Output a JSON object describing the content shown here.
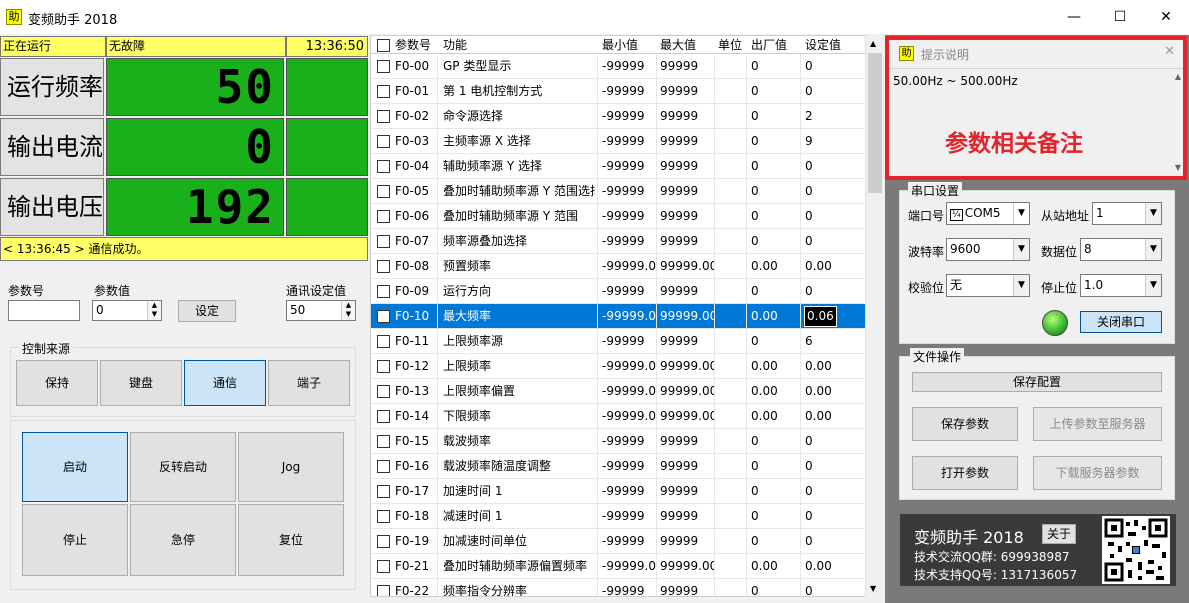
{
  "window": {
    "title": "变频助手 2018",
    "icon_glyph": "助",
    "minimize": "—",
    "maximize": "☐",
    "close": "✕"
  },
  "status": {
    "running": "正在运行",
    "fault": "无故障",
    "clock": "13:36:50"
  },
  "readouts": [
    {
      "label": "运行频率",
      "value": "50"
    },
    {
      "label": "输出电流",
      "value": "0"
    },
    {
      "label": "输出电压",
      "value": "192"
    }
  ],
  "message": "< 13:36:45 > 通信成功。",
  "param_form": {
    "param_no_label": "参数号",
    "param_no_value": "",
    "param_val_label": "参数值",
    "param_val_value": "0",
    "set_button": "设定",
    "comm_label": "通讯设定值",
    "comm_value": "50"
  },
  "control_source": {
    "title": "控制来源",
    "buttons": [
      "保持",
      "键盘",
      "通信",
      "端子"
    ],
    "active": "通信"
  },
  "control_buttons": [
    "启动",
    "反转启动",
    "Jog",
    "停止",
    "急停",
    "复位"
  ],
  "grid": {
    "headers": [
      "参数号",
      "功能",
      "最小值",
      "最大值",
      "单位",
      "出厂值",
      "设定值"
    ],
    "rows": [
      [
        "F0-00",
        "GP 类型显示",
        "-99999",
        "99999",
        "",
        "0",
        "0"
      ],
      [
        "F0-01",
        "第 1 电机控制方式",
        "-99999",
        "99999",
        "",
        "0",
        "0"
      ],
      [
        "F0-02",
        "命令源选择",
        "-99999",
        "99999",
        "",
        "0",
        "2"
      ],
      [
        "F0-03",
        "主频率源 X 选择",
        "-99999",
        "99999",
        "",
        "0",
        "9"
      ],
      [
        "F0-04",
        "辅助频率源 Y 选择",
        "-99999",
        "99999",
        "",
        "0",
        "0"
      ],
      [
        "F0-05",
        "叠加时辅助频率源 Y 范围选择",
        "-99999",
        "99999",
        "",
        "0",
        "0"
      ],
      [
        "F0-06",
        "叠加时辅助频率源 Y 范围",
        "-99999",
        "99999",
        "",
        "0",
        "0"
      ],
      [
        "F0-07",
        "频率源叠加选择",
        "-99999",
        "99999",
        "",
        "0",
        "0"
      ],
      [
        "F0-08",
        "预置频率",
        "-99999.0",
        "99999.00",
        "",
        "0.00",
        "0.00"
      ],
      [
        "F0-09",
        "运行方向",
        "-99999",
        "99999",
        "",
        "0",
        "0"
      ],
      [
        "F0-10",
        "最大频率",
        "-99999.0",
        "99999.00",
        "",
        "0.00",
        "0.06"
      ],
      [
        "F0-11",
        "上限频率源",
        "-99999",
        "99999",
        "",
        "0",
        "6"
      ],
      [
        "F0-12",
        "上限频率",
        "-99999.0",
        "99999.00",
        "",
        "0.00",
        "0.00"
      ],
      [
        "F0-13",
        "上限频率偏置",
        "-99999.0",
        "99999.00",
        "",
        "0.00",
        "0.00"
      ],
      [
        "F0-14",
        "下限频率",
        "-99999.0",
        "99999.00",
        "",
        "0.00",
        "0.00"
      ],
      [
        "F0-15",
        "载波频率",
        "-99999",
        "99999",
        "",
        "0",
        "0"
      ],
      [
        "F0-16",
        "载波频率随温度调整",
        "-99999",
        "99999",
        "",
        "0",
        "0"
      ],
      [
        "F0-17",
        "加速时间 1",
        "-99999",
        "99999",
        "",
        "0",
        "0"
      ],
      [
        "F0-18",
        "减速时间 1",
        "-99999",
        "99999",
        "",
        "0",
        "0"
      ],
      [
        "F0-19",
        "加减速时间单位",
        "-99999",
        "99999",
        "",
        "0",
        "0"
      ],
      [
        "F0-21",
        "叠加时辅助频率源偏置频率",
        "-99999.0",
        "99999.00",
        "",
        "0.00",
        "0.00"
      ],
      [
        "F0-22",
        "频率指令分辨率",
        "-99999",
        "99999",
        "",
        "0",
        "0"
      ]
    ],
    "selected_row": 10
  },
  "hint": {
    "title": "提示说明",
    "range": "50.00Hz ~ 500.00Hz",
    "note": "参数相关备注"
  },
  "serial": {
    "title": "串口设置",
    "port_label": "端口号",
    "port_value": "COM5",
    "slave_label": "从站地址",
    "slave_value": "1",
    "baud_label": "波特率",
    "baud_value": "9600",
    "databits_label": "数据位",
    "databits_value": "8",
    "parity_label": "校验位",
    "parity_value": "无",
    "stopbits_label": "停止位",
    "stopbits_value": "1.0",
    "close_button": "关闭串口"
  },
  "file_ops": {
    "title": "文件操作",
    "save_config": "保存配置",
    "save_params": "保存参数",
    "upload": "上传参数至服务器",
    "open_params": "打开参数",
    "download": "下载服务器参数"
  },
  "about": {
    "name": "变频助手 2018",
    "about_button": "关于",
    "qq_group": "技术交流QQ群:  699938987",
    "qq_support": "技术支持QQ号: 1317136057"
  },
  "colors": {
    "lcd_green": "#19b01c",
    "status_yellow": "#ffff66",
    "selection_blue": "#0078d7",
    "note_red": "#e3242b"
  }
}
